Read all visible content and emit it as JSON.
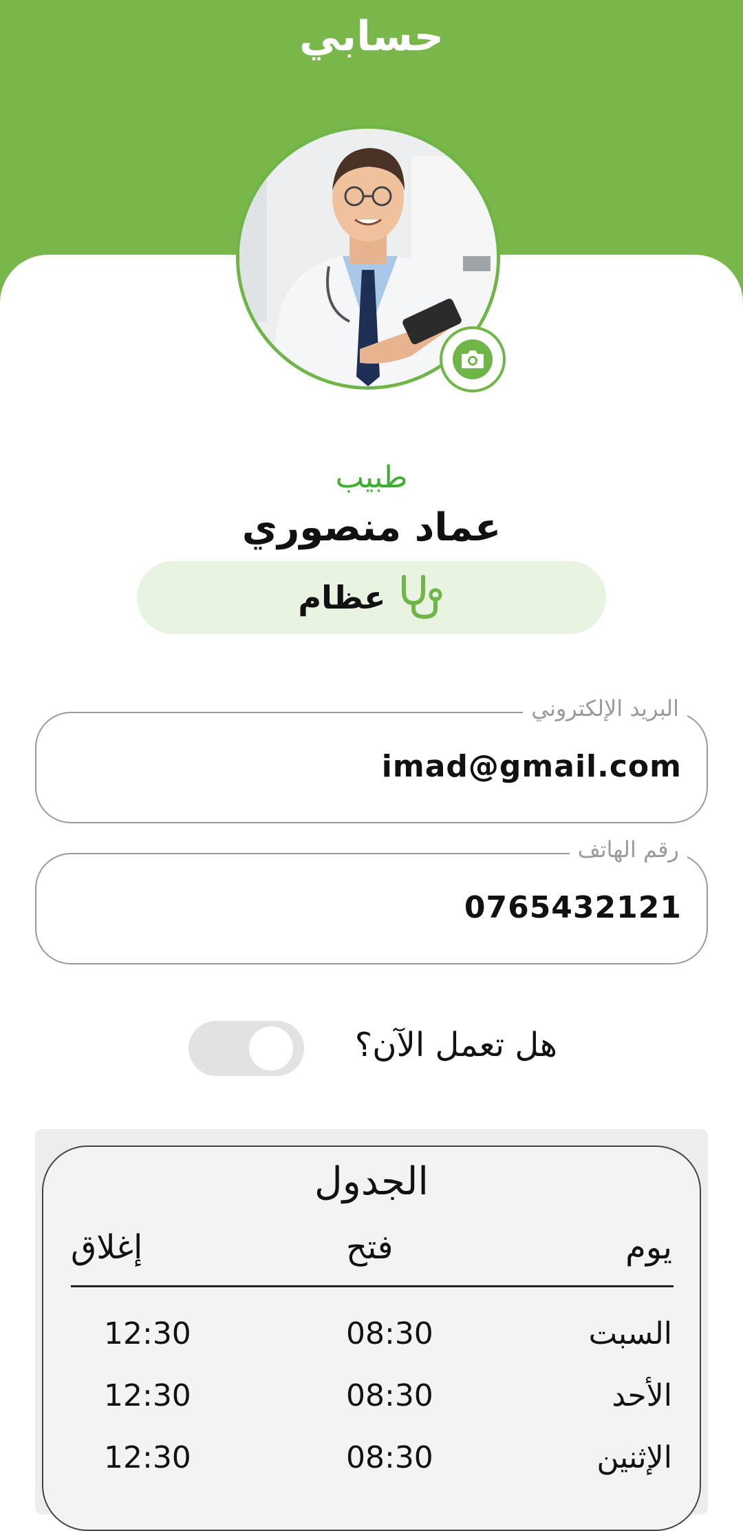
{
  "header": {
    "title": "حسابي"
  },
  "profile": {
    "role": "طبيب",
    "name": "عماد منصوري",
    "specialty": "عظام"
  },
  "fields": {
    "email": {
      "label": "البريد الإلكتروني",
      "value": "imad@gmail.com"
    },
    "phone": {
      "label": "رقم الهاتف",
      "value": "0765432121"
    }
  },
  "work_status": {
    "question": "هل تعمل الآن؟",
    "toggle_on": false
  },
  "schedule": {
    "title": "الجدول",
    "columns": {
      "day": "يوم",
      "open": "فتح",
      "close": "إغلاق"
    },
    "rows": [
      {
        "day": "السبت",
        "open": "08:30",
        "close": "12:30"
      },
      {
        "day": "الأحد",
        "open": "08:30",
        "close": "12:30"
      },
      {
        "day": "الإثنين",
        "open": "08:30",
        "close": "12:30"
      }
    ]
  },
  "colors": {
    "brand": "#79b74b",
    "accent": "#6fb548",
    "role": "#3bae2d",
    "chip": "#e8f3e2"
  },
  "icons": {
    "camera": "camera-icon",
    "specialty": "stethoscope-icon"
  }
}
